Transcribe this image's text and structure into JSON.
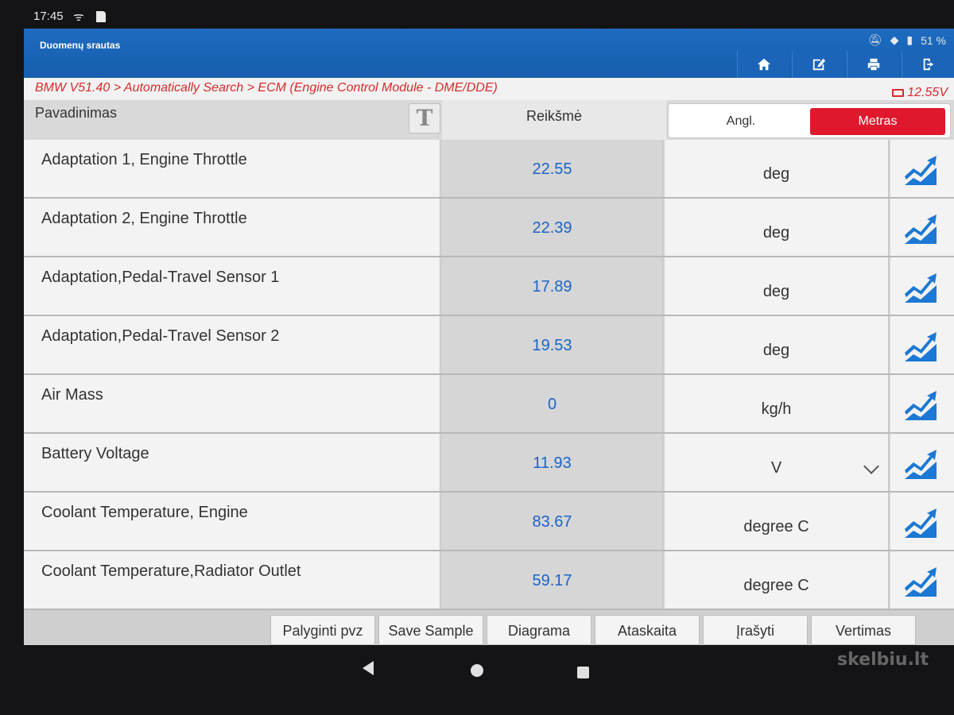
{
  "status_bar": {
    "time": "17:45",
    "battery": "51 %"
  },
  "app": {
    "title": "Duomenų srautas",
    "breadcrumb": "BMW V51.40 > Automatically Search > ECM (Engine Control Module - DME/DDE)",
    "voltage": "12.55V",
    "toolbar_icons": [
      "home-icon",
      "edit-icon",
      "print-icon",
      "exit-icon"
    ]
  },
  "table": {
    "header_name": "Pavadinimas",
    "header_value": "Reikšmė",
    "t_button": "T",
    "unit_options": {
      "english": "Angl.",
      "metric": "Metras",
      "selected": "metric"
    },
    "rows": [
      {
        "name": "Adaptation 1, Engine Throttle",
        "value": "22.55",
        "unit": "deg"
      },
      {
        "name": "Adaptation 2, Engine Throttle",
        "value": "22.39",
        "unit": "deg"
      },
      {
        "name": "Adaptation,Pedal-Travel Sensor 1",
        "value": "17.89",
        "unit": "deg"
      },
      {
        "name": "Adaptation,Pedal-Travel Sensor 2",
        "value": "19.53",
        "unit": "deg"
      },
      {
        "name": "Air Mass",
        "value": "0",
        "unit": "kg/h"
      },
      {
        "name": "Battery Voltage",
        "value": "11.93",
        "unit": "V"
      },
      {
        "name": "Coolant Temperature, Engine",
        "value": "83.67",
        "unit": "degree C"
      },
      {
        "name": "Coolant Temperature,Radiator Outlet",
        "value": "59.17",
        "unit": "degree C"
      }
    ]
  },
  "bottom_buttons": [
    {
      "label": "Palyginti pvz"
    },
    {
      "label": "Save Sample"
    },
    {
      "label": "Diagrama"
    },
    {
      "label": "Ataskaita"
    },
    {
      "label": "Įrašyti"
    },
    {
      "label": "Vertimas"
    }
  ],
  "watermark": "skelbiu.lt",
  "colors": {
    "titlebar": "#1d6bc0",
    "accent_red": "#e0182e",
    "value_blue": "#1a64c8",
    "breadcrumb_red": "#d62b2b"
  }
}
